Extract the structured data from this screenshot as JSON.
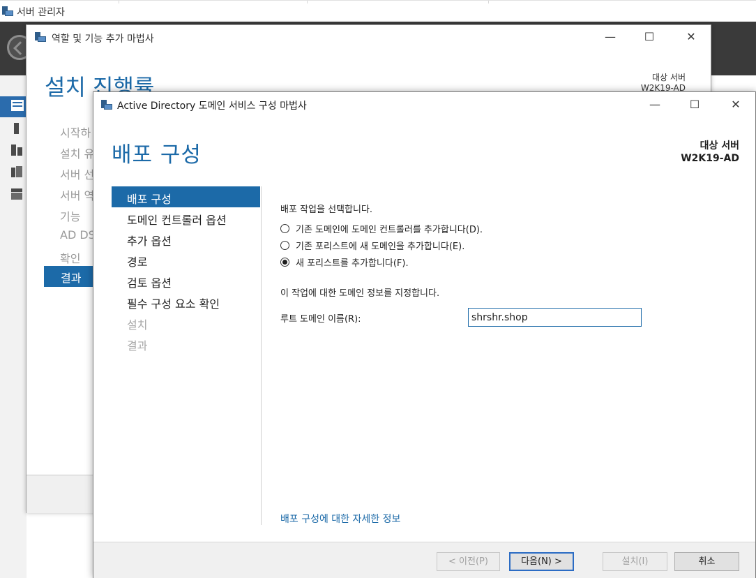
{
  "server_manager": {
    "title": "서버 관리자"
  },
  "add_roles_wizard": {
    "title": "역할 및 기능 추가 마법사",
    "heading": "설치 진행률",
    "target_label": "대상 서버",
    "target_name": "W2K19-AD",
    "nav_items": [
      "시작하",
      "설치 유",
      "서버 선",
      "서버 역",
      "기능",
      "AD DS",
      "확인",
      "결과"
    ],
    "selected_nav": "결과"
  },
  "adds_wizard": {
    "title": "Active Directory 도메인 서비스 구성 마법사",
    "heading": "배포 구성",
    "target_label": "대상 서버",
    "target_name": "W2K19-AD",
    "window_controls": {
      "minimize": "—",
      "maximize": "☐",
      "close": "✕"
    },
    "nav_items": [
      {
        "label": "배포 구성",
        "state": "selected"
      },
      {
        "label": "도메인 컨트롤러 옵션",
        "state": "normal"
      },
      {
        "label": "추가 옵션",
        "state": "normal"
      },
      {
        "label": "경로",
        "state": "normal"
      },
      {
        "label": "검토 옵션",
        "state": "normal"
      },
      {
        "label": "필수 구성 요소 확인",
        "state": "normal"
      },
      {
        "label": "설치",
        "state": "disabled"
      },
      {
        "label": "결과",
        "state": "disabled"
      }
    ],
    "select_operation_label": "배포 작업을 선택합니다.",
    "operations": [
      {
        "label": "기존 도메인에 도메인 컨트롤러를 추가합니다(D).",
        "selected": false
      },
      {
        "label": "기존 포리스트에 새 도메인을 추가합니다(E).",
        "selected": false
      },
      {
        "label": "새 포리스트를 추가합니다(F).",
        "selected": true
      }
    ],
    "domain_info_label": "이 작업에 대한 도메인 정보를 지정합니다.",
    "root_domain_label": "루트 도메인 이름(R):",
    "root_domain_value": "shrshr.shop",
    "more_info_link": "배포 구성에 대한 자세한 정보",
    "buttons": {
      "previous": "< 이전(P)",
      "next": "다음(N) >",
      "install": "설치(I)",
      "cancel": "취소"
    }
  },
  "colors": {
    "accent": "#1c6aa8",
    "header_dark": "#3a3a3a",
    "footer": "#f0f0f0",
    "disabled_text": "#a8a8a8"
  }
}
